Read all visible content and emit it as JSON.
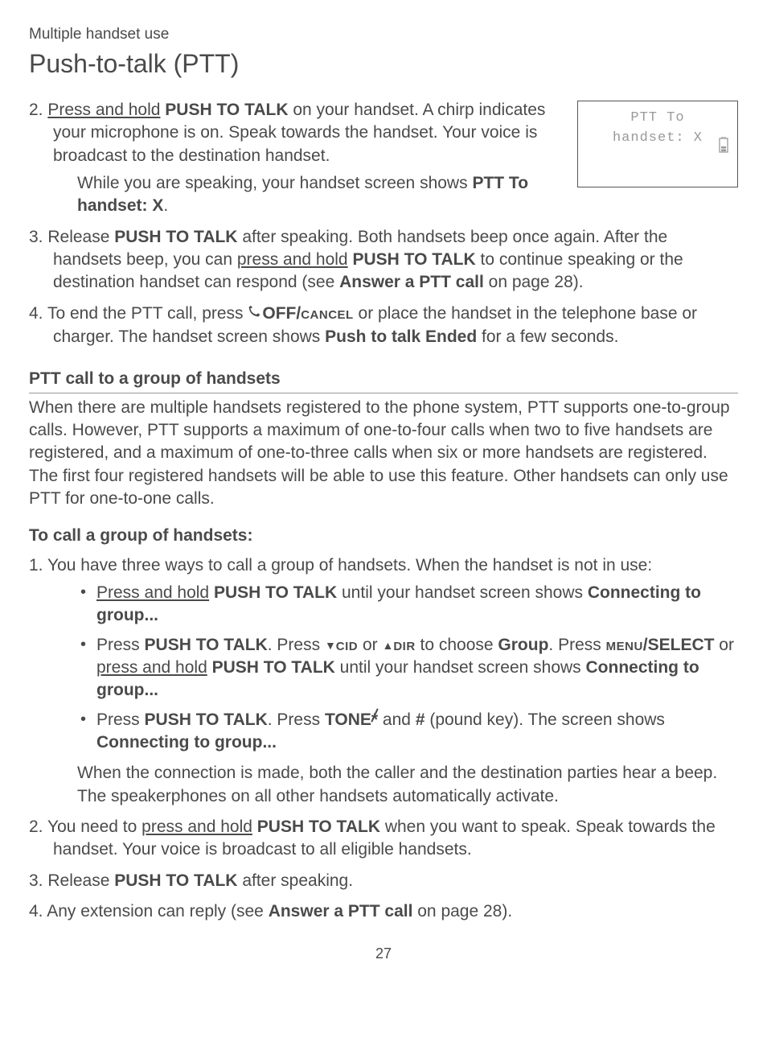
{
  "header": {
    "section_label": "Multiple handset use",
    "page_title": "Push-to-talk (PTT)"
  },
  "screen": {
    "line1": "PTT To",
    "line2": "handset: X"
  },
  "step2": {
    "num": "2.",
    "t1": "Press and hold",
    "t2": " ",
    "b1": "PUSH TO TALK",
    "t3": " on your handset. A chirp indicates your microphone is on. Speak towards the handset. Your voice is broadcast to the destination handset.",
    "sub_t1": "While you are speaking, your handset screen shows ",
    "sub_b1": "PTT To handset: X",
    "sub_t2": "."
  },
  "step3": {
    "num": "3.",
    "t1": "Release ",
    "b1": "PUSH TO TALK",
    "t2": " after speaking. Both handsets beep once again. After the handsets beep, you can ",
    "u1": "press and hold",
    "t3": " ",
    "b2": "PUSH TO TALK",
    "t4": " to continue speaking or the destination handset can respond (see ",
    "b3": "Answer a PTT call",
    "t5": " on page 28)."
  },
  "step4": {
    "num": "4.",
    "t1": "To end the PTT call, press ",
    "b1": "OFF/",
    "sc1": "cancel",
    "t2": " or place the handset in the telephone base or charger. The handset screen shows ",
    "b2": "Push to talk Ended",
    "t3": " for a few seconds."
  },
  "group_heading": "PTT call to a group of handsets",
  "group_intro": "When there are multiple handsets registered to the phone system, PTT supports one-to-group calls. However, PTT supports a maximum of one-to-four calls when two to five handsets are registered, and a maximum of one-to-three calls when six or more handsets are registered. The first four registered handsets will be able to use this feature. Other handsets can only use PTT for one-to-one calls.",
  "to_call_heading": "To call a group of handsets:",
  "gstep1": {
    "num": "1.",
    "t1": "You have three ways to call a group of handsets. When the handset is not in use:",
    "bul1": {
      "u1": "Press and hold",
      "t1": " ",
      "b1": "PUSH TO TALK",
      "t2": " until your handset screen shows ",
      "b2": "Connecting to group..."
    },
    "bul2": {
      "t1": "Press ",
      "b1": "PUSH TO TALK",
      "t2": ". Press ",
      "sc_cid": "cid",
      "t3": " or ",
      "sc_dir": "dir",
      "t4": " to choose ",
      "b_group": "Group",
      "t5": ". Press ",
      "sc_menu": "menu",
      "b_select": "/SELECT",
      "t6": " or ",
      "u1": "press and hold",
      "t7": " ",
      "b2": "PUSH TO TALK",
      "t8": " until your handset screen shows ",
      "b3": "Connecting to group..."
    },
    "bul3": {
      "t1": "Press ",
      "b1": "PUSH TO TALK",
      "t2": ". Press ",
      "b_tone": "TONE",
      "t3": " and ",
      "b_hash": "#",
      "t4": " (pound key). The screen shows ",
      "b2": "Connecting to group..."
    },
    "aft": "When the connection is made, both the caller and the destination parties hear a beep. The speakerphones on all other handsets automatically activate."
  },
  "gstep2": {
    "num": "2.",
    "t1": "You need to ",
    "u1": "press and hold",
    "t2": " ",
    "b1": "PUSH TO TALK",
    "t3": " when you want to speak. Speak towards the handset. Your voice is broadcast to all eligible handsets."
  },
  "gstep3": {
    "num": "3.",
    "t1": "Release ",
    "b1": "PUSH TO TALK",
    "t2": " after speaking."
  },
  "gstep4": {
    "num": "4.",
    "t1": "Any extension can reply (see ",
    "b1": "Answer a PTT call",
    "t2": " on page 28)."
  },
  "page_number": "27"
}
